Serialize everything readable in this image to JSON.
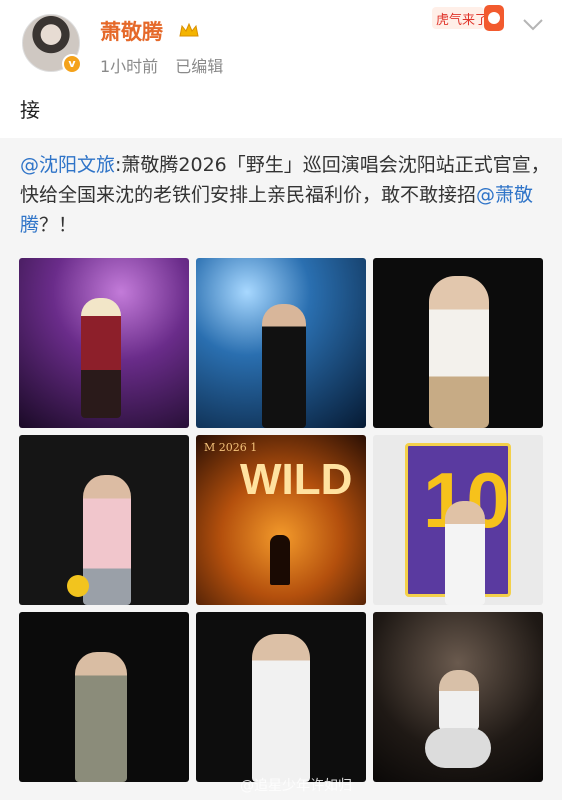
{
  "header": {
    "username": "萧敬腾",
    "time": "1小时前",
    "edited": "已编辑",
    "sticker_text": "虎气来了"
  },
  "post": {
    "text": "接"
  },
  "repost": {
    "mention_1": "@沈阳文旅",
    "body": ":萧敬腾2026「野生」巡回演唱会沈阳站正式官宣，快给全国来沈的老铁们安排上亲民福利价，敢不敢接招",
    "mention_2": "@萧敬腾",
    "suffix": "？！"
  },
  "photos": {
    "wild_poster_text": "WILD",
    "poster_top_text": "M 2026 1",
    "card_number": "10"
  },
  "watermark": "@追星少年许如归",
  "colors": {
    "username": "#e5692a",
    "mention": "#2f74c8",
    "repost_bg": "#f5f5f5"
  }
}
